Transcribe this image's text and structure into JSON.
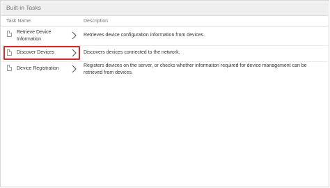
{
  "panel": {
    "title": "Built-in Tasks"
  },
  "columns": {
    "name": "Task Name",
    "description": "Description"
  },
  "tasks": [
    {
      "name": "Retrieve Device Information",
      "description": "Retrieves device configuration information from devices."
    },
    {
      "name": "Discover Devices",
      "description": "Discovers devices connected to the network."
    },
    {
      "name": "Device Registration",
      "description": "Registers devices on the server, or checks whether information required for device management can be retrieved from devices."
    }
  ],
  "colors": {
    "highlight": "#d62a2a",
    "header_bg": "#efefef"
  },
  "icons": {
    "task": "document-icon",
    "open": "chevron-right-icon"
  },
  "selected_task": "Discover Devices"
}
